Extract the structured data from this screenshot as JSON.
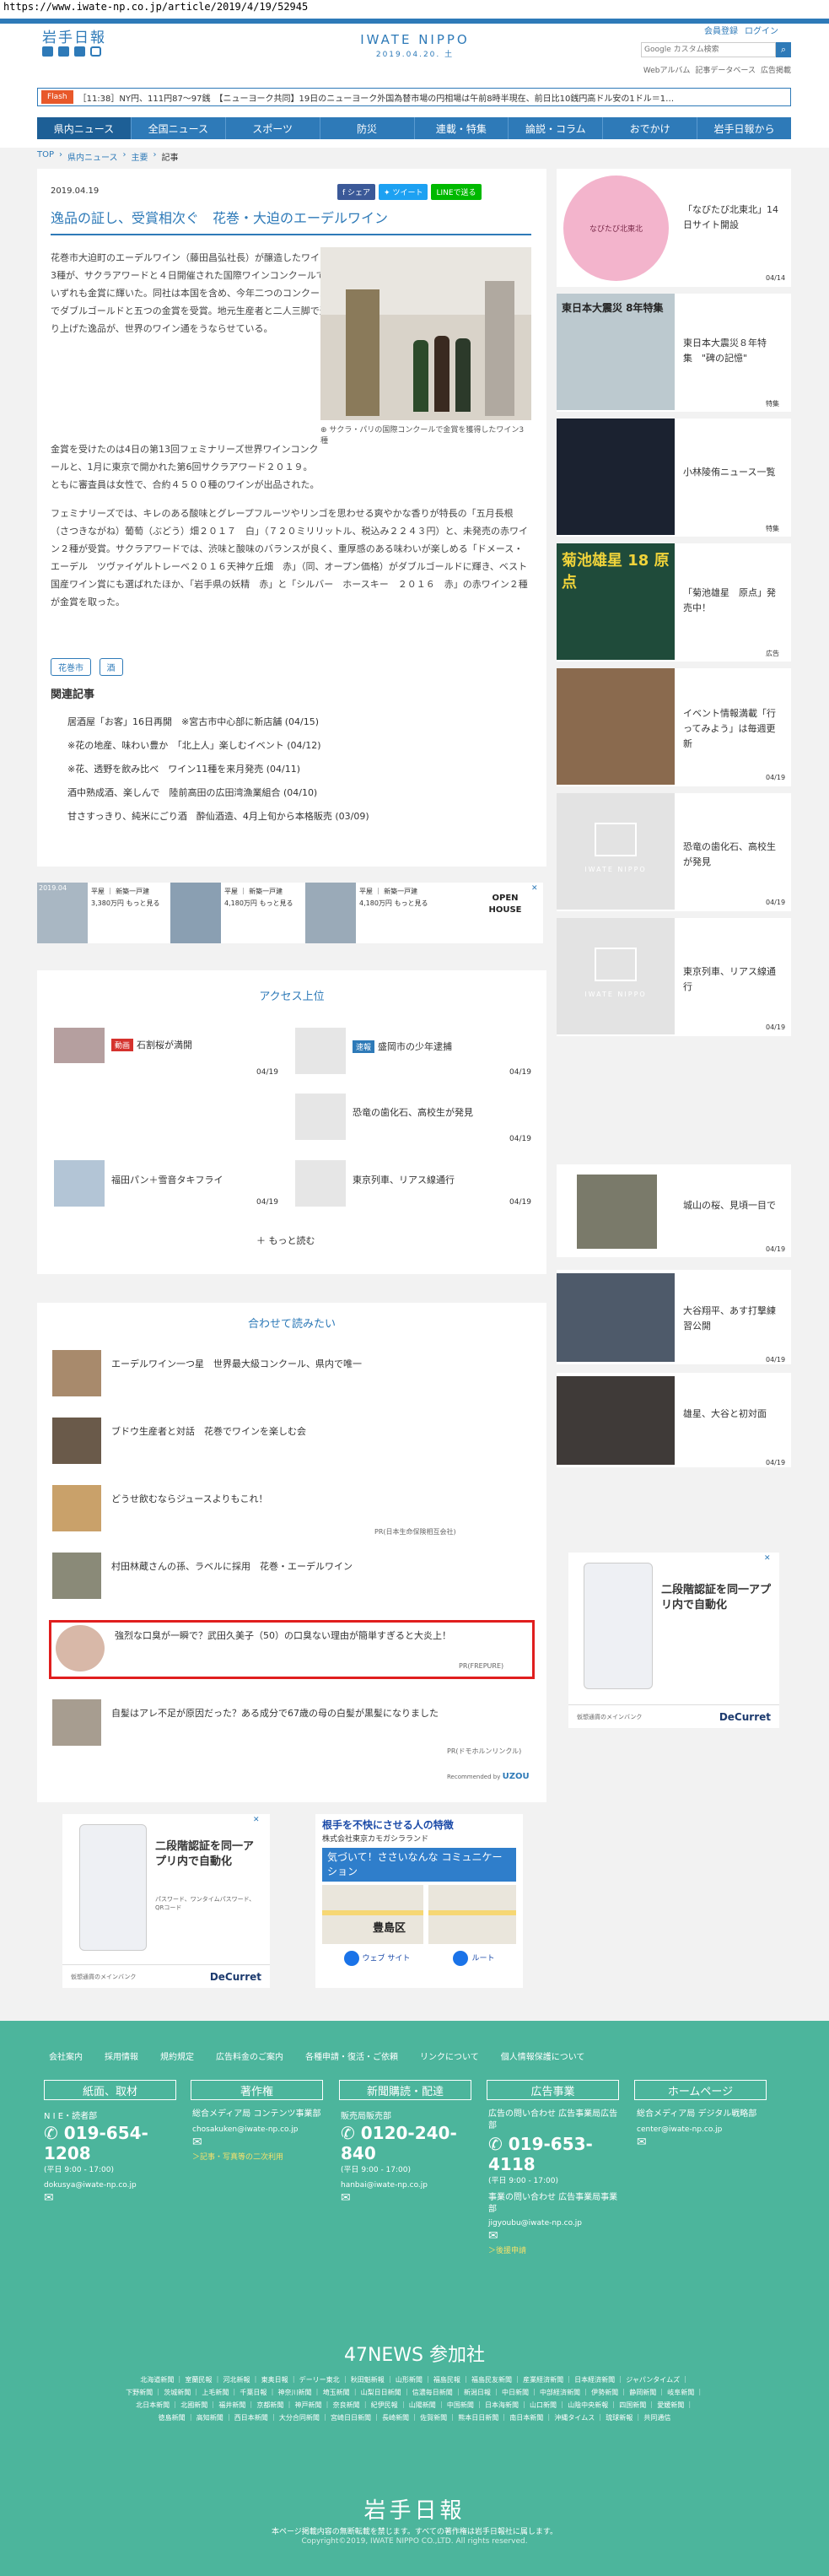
{
  "url": "https://www.iwate-np.co.jp/article/2019/4/19/52945",
  "header": {
    "logo_left": "岩手日報",
    "logo_center": "IWATE NIPPO",
    "date": "2019.04.20. 土",
    "user_links": [
      "会員登録",
      "ログイン"
    ],
    "search_placeholder": "Google カスタム検索",
    "sub_links": [
      "Webアルバム",
      "記事データベース",
      "広告掲載"
    ]
  },
  "flash": {
    "label": "Flash",
    "text": "［11:38］NY円、111円87～97銭　【ニューヨーク共同】19日のニューヨーク外国為替市場の円相場は午前8時半現在、前日比10銭円高ドル安の1ドル＝1…"
  },
  "nav": [
    "県内ニュース",
    "全国ニュース",
    "スポーツ",
    "防災",
    "連載・特集",
    "論説・コラム",
    "おでかけ",
    "岩手日報から"
  ],
  "breadcrumb": [
    "TOP",
    "県内ニュース",
    "主要",
    "記事"
  ],
  "article": {
    "date": "2019.04.19",
    "share_fb": "シェア",
    "share_tw": "ツイート",
    "share_line": "LINEで送る",
    "title": "逸品の証し、受賞相次ぐ　花巻・大迫のエーデルワイン",
    "p1": "花巻市大迫町のエーデルワイン（藤田昌弘社長）が醸造したワイン3種が、サクラアワードと４日開催された国際ワインコンクールでいずれも金賞に輝いた。同社は本国を含め、今年二つのコンクールでダブルゴールドと五つの金賞を受賞。地元生産者と二人三脚で造り上げた逸品が、世界のワイン通をうならせている。",
    "caption": "サクラ・パリの国際コンクールで金賞を獲得したワイン3種",
    "p2": "金賞を受けたのは4日の第13回フェミナリーズ世界ワインコンクールと、1月に東京で開かれた第6回サクラアワード２０１９。ともに審査員は女性で、合約４５００種のワインが出品された。",
    "p3": "フェミナリーズでは、キレのある酸味とグレープフルーツやリンゴを思わせる爽やかな香りが特長の「五月長根（さつきながね）葡萄（ぶどう）畑２０１７　白」（７２０ミリリットル、税込み２２４３円）と、未発売の赤ワイン２種が受賞。サクラアワードでは、渋味と酸味のバランスが良く、重厚感のある味わいが楽しめる「ドメース・エーデル　ツヴァイゲルトレーベ２０１６天神ケ丘畑　赤」（同、オープン価格）がダブルゴールドに輝き、ベスト国産ワイン賞にも選ばれたほか、「岩手県の妖精　赤」と「シルバー　ホースキー　２０１６　赤」の赤ワイン２種が金賞を取った。",
    "tags": [
      "花巻市",
      "酒"
    ],
    "related_title": "関連記事",
    "related": [
      "居酒屋「お客」16日再開　※宮古市中心部に新店舗 (04/15)",
      "※花の地産、味わい豊か　「北上人」楽しむイベント (04/12)",
      "※花、透野を飲み比べ　ワイン11種を来月発売 (04/11)",
      "酒中熟成酒、楽しんで　陸前高田の広田湾漁業組合 (04/10)",
      "甘さすっきり、純米にごり酒　酔仙酒造、4月上旬から本格販売 (03/09)"
    ]
  },
  "ad_strip": {
    "items": [
      {
        "tag": "2019.04",
        "text": "平屋 ｜ 新築一戸建 3,380万円 もっと見る"
      },
      {
        "tag": "",
        "text": "平屋 ｜ 新築一戸建 4,180万円 もっと見る"
      },
      {
        "tag": "",
        "text": "平屋 ｜ 新築一戸建 4,180万円 もっと見る"
      }
    ],
    "open_house": "OPEN HOUSE"
  },
  "access_ranking": {
    "title": "アクセス上位",
    "items": [
      {
        "chip": "動画",
        "text": "石割桜が満開",
        "date": "04/19"
      },
      {
        "chip": "速報",
        "text": "盛岡市の少年逮捕",
        "date": "04/19"
      },
      {
        "chip": "",
        "text": "恐竜の歯化石、高校生が発見",
        "date": "04/19"
      },
      {
        "chip": "",
        "text": "福田パン＋雪音タキフライ",
        "date": "04/19"
      },
      {
        "chip": "",
        "text": "東京列車、リアス線通行",
        "date": "04/19"
      }
    ],
    "more": "もっと読む"
  },
  "also_read": {
    "title": "合わせて読みたい",
    "items": [
      {
        "text": "エーデルワイン一つ星　世界最大級コンクール、県内で唯一",
        "sponsor": ""
      },
      {
        "text": "ブドウ生産者と対話　花巻でワインを楽しむ会",
        "sponsor": ""
      },
      {
        "text": "どうせ飲むならジュースよりもこれ！",
        "sponsor": "PR(日本生命保険相互会社)"
      },
      {
        "text": "村田林蔵さんの孫、ラベルに採用　花巻・エーデルワイン",
        "sponsor": ""
      },
      {
        "text": "強烈な口臭が一瞬で？武田久美子（50）の口臭ない理由が簡単すぎると大炎上！",
        "sponsor": "PR(FREPURE)"
      },
      {
        "text": "自髪はアレ不足が原因だった？ある成分で67歳の母の白髪が黒髪になりました",
        "sponsor": "PR(ドモホルンリンクル)"
      }
    ],
    "recommended_by": "Recommended by",
    "brand": "UZOU"
  },
  "bottom_ads": {
    "left_head": "二段階認証を同一アプリ内で自動化",
    "left_sub": "パスワード、ワンタイムパスワード、QRコード",
    "left_brand": "DeCurret",
    "left_footer": "仮想通貨のメインバンク",
    "right_head": "根手を不快にさせる人の特徴",
    "right_company": "株式会社東京カモガシラランド",
    "right_box": "気づいて！ささいなんな コミュニケーション",
    "right_map": "豊島区",
    "right_btn1": "ウェブ サイト",
    "right_btn2": "ルート"
  },
  "side": [
    {
      "text": "「なびたび北東北」14日サイト開設",
      "date": "04/14",
      "img_text": "なびたび北東北"
    },
    {
      "text": "東日本大震災８年特集　\"碑の記憶\"",
      "date": "特集",
      "img_text": "東日本大震災 8年特集"
    },
    {
      "text": "小林陵侑ニュース一覧",
      "date": "特集",
      "img_text": ""
    },
    {
      "text": "「菊池雄星　原点」発売中！",
      "date": "広告",
      "img_text": "菊池雄星 18 原点"
    },
    {
      "text": "イベント情報満載「行ってみよう」は毎週更新",
      "date": "04/19",
      "img_text": ""
    },
    {
      "text": "恐竜の歯化石、高校生が発見",
      "date": "04/19",
      "img_text": "IWATE NIPPO"
    },
    {
      "text": "東京列車、リアス線通行",
      "date": "04/19",
      "img_text": "IWATE NIPPO"
    },
    {
      "text": "城山の桜、見頃一目で",
      "date": "04/19",
      "img_text": ""
    },
    {
      "text": "大谷翔平、あす打撃練習公開",
      "date": "04/19",
      "img_text": ""
    },
    {
      "text": "雄星、大谷と初対面",
      "date": "04/19",
      "img_text": ""
    }
  ],
  "side_ad": {
    "head": "二段階認証を同一アプリ内で自動化",
    "brand": "DeCurret",
    "footer": "仮想通貨のメインバンク"
  },
  "footer": {
    "links": [
      "会社案内",
      "採用情報",
      "規約規定",
      "広告料金のご案内",
      "各種申請・復活・ご依頼",
      "リンクについて",
      "個人情報保護について"
    ],
    "boxes": [
      "紙面、取材",
      "著作権",
      "新聞購読・配達",
      "広告事業",
      "ホームページ"
    ],
    "col1": {
      "label": "N I E・読者部",
      "tel": "019-654-1208",
      "hours": "(平日 9:00 - 17:00)",
      "mail": "dokusya@iwate-np.co.jp"
    },
    "col2": {
      "label": "総合メディア局 コンテンツ事業部",
      "mail": "chosakuken@iwate-np.co.jp",
      "link": "＞記事・写真等の二次利用"
    },
    "col3": {
      "label": "販売局販売部",
      "tel": "0120-240-840",
      "hours": "(平日 9:00 - 17:00)",
      "mail": "hanbai@iwate-np.co.jp"
    },
    "col4": {
      "label": "広告の問い合わせ 広告事業局広告部",
      "tel": "019-653-4118",
      "hours": "(平日 9:00 - 17:00)",
      "label2": "事業の問い合わせ 広告事業局事業部",
      "mail": "jigyoubu@iwate-np.co.jp",
      "link": "＞後援申請"
    },
    "col5": {
      "label": "総合メディア局 デジタル戦略部",
      "mail": "center@iwate-np.co.jp"
    },
    "news47_title": "47NEWS 参加社",
    "news47_line1": "北海道新聞 ｜ 室蘭民報 ｜ 河北新報 ｜ 東奥日報 ｜ デーリー東北 ｜ 秋田魁新報 ｜ 山形新聞 ｜ 福島民報 ｜ 福島民友新聞 ｜ 産業経済新聞 ｜ 日本経済新聞 ｜ ジャパンタイムズ ｜",
    "news47_line2": "下野新聞 ｜ 茨城新聞 ｜ 上毛新聞 ｜ 千葉日報 ｜ 神奈川新聞 ｜ 埼玉新聞 ｜ 山梨日日新聞 ｜ 信濃毎日新聞 ｜ 新潟日報 ｜ 中日新聞 ｜ 中部経済新聞 ｜ 伊勢新聞 ｜ 静岡新聞 ｜ 岐阜新聞 ｜",
    "news47_line3": "北日本新聞 ｜ 北國新聞 ｜ 福井新聞 ｜ 京都新聞 ｜ 神戸新聞 ｜ 奈良新聞 ｜ 紀伊民報 ｜ 山陽新聞 ｜ 中国新聞 ｜ 日本海新聞 ｜ 山口新聞 ｜ 山陰中央新報 ｜ 四国新聞 ｜ 愛媛新聞 ｜",
    "news47_line4": "徳島新聞 ｜ 高知新聞 ｜ 西日本新聞 ｜ 大分合同新聞 ｜ 宮崎日日新聞 ｜ 長崎新聞 ｜ 佐賀新聞 ｜ 熊本日日新聞 ｜ 南日本新聞 ｜ 沖縄タイムス ｜ 琉球新報 ｜ 共同通信",
    "logo": "岩手日報",
    "copyright1": "本ページ掲載内容の無断転載を禁じます。すべての著作権は岩手日報社に属します。",
    "copyright2": "Copyright©2019, IWATE NIPPO CO.,LTD. All rights reserved."
  }
}
